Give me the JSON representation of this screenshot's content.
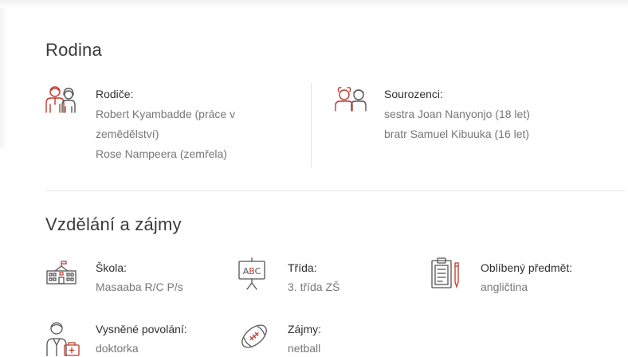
{
  "family": {
    "title": "Rodina",
    "parents": {
      "label": "Rodiče:",
      "lines": [
        "Robert Kyambadde (práce v",
        "zemědělství)",
        "Rose Nampeera (zemřela)"
      ]
    },
    "siblings": {
      "label": "Sourozenci:",
      "lines": [
        "sestra Joan Nanyonjo (18 let)",
        "bratr Samuel Kibuuka (16 let)"
      ]
    }
  },
  "education": {
    "title": "Vzdělání a zájmy",
    "school": {
      "label": "Škola:",
      "value": "Masaaba R/C P/s"
    },
    "grade": {
      "label": "Třída:",
      "value": "3. třída ZŠ"
    },
    "favorite_subject": {
      "label": "Oblíbený předmět:",
      "value": "angličtina"
    },
    "dream_job": {
      "label": "Vysněné povolání:",
      "value": "doktorka"
    },
    "interests": {
      "label": "Zájmy:",
      "value": "netball"
    }
  },
  "icons": {
    "parents": "parents-icon",
    "siblings": "siblings-icon",
    "school": "school-building-icon",
    "grade": "abc-board-icon",
    "favorite_subject": "clipboard-pencil-icon",
    "dream_job": "doctor-icon",
    "interests": "rugby-ball-icon"
  },
  "colors": {
    "accent": "#c0392b",
    "icon_gray": "#555555",
    "label": "#2f2f2f",
    "value": "#777777"
  }
}
